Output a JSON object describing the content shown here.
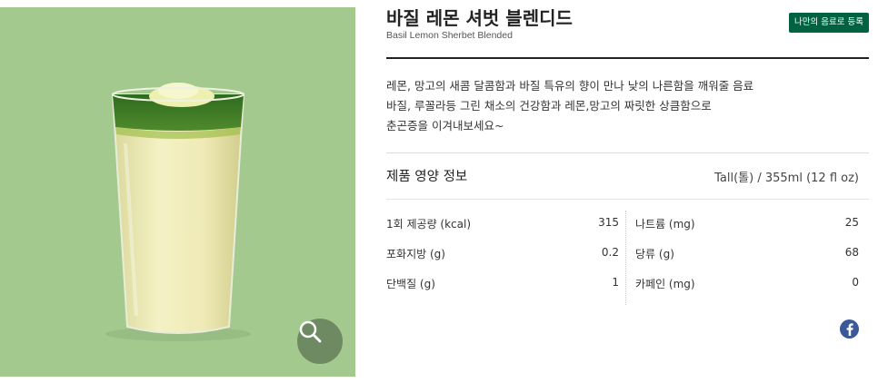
{
  "product": {
    "title": "바질 레몬 셔벗 블렌디드",
    "subtitle": "Basil Lemon Sherbet Blended",
    "register_label": "나만의 음료로 등록",
    "description_lines": [
      "레몬, 망고의 새콤 달콤함과 바질 특유의 향이 만나 낮의 나른함을 깨워줄 음료",
      "바질, 루꼴라등 그린 채소의 건강함과 레몬,망고의 짜릿한 상큼함으로",
      "춘곤증을 이겨내보세요~"
    ]
  },
  "nutrition": {
    "title": "제품 영양 정보",
    "serving": "Tall(톨) / 355ml (12 fl oz)",
    "rows": [
      {
        "label1": "1회 제공량 (kcal)",
        "value1": "315",
        "label2": "나트륨 (mg)",
        "value2": "25"
      },
      {
        "label1": "포화지방 (g)",
        "value1": "0.2",
        "label2": "당류 (g)",
        "value2": "68"
      },
      {
        "label1": "단백질 (g)",
        "value1": "1",
        "label2": "카페인 (mg)",
        "value2": "0"
      }
    ]
  },
  "icons": {
    "zoom": "magnifier-icon",
    "social": "facebook-icon"
  },
  "colors": {
    "photo_background": "#a3c98f",
    "brand_green": "#006241",
    "zoom_button": "#6d8a63",
    "facebook": "#3b5998"
  }
}
